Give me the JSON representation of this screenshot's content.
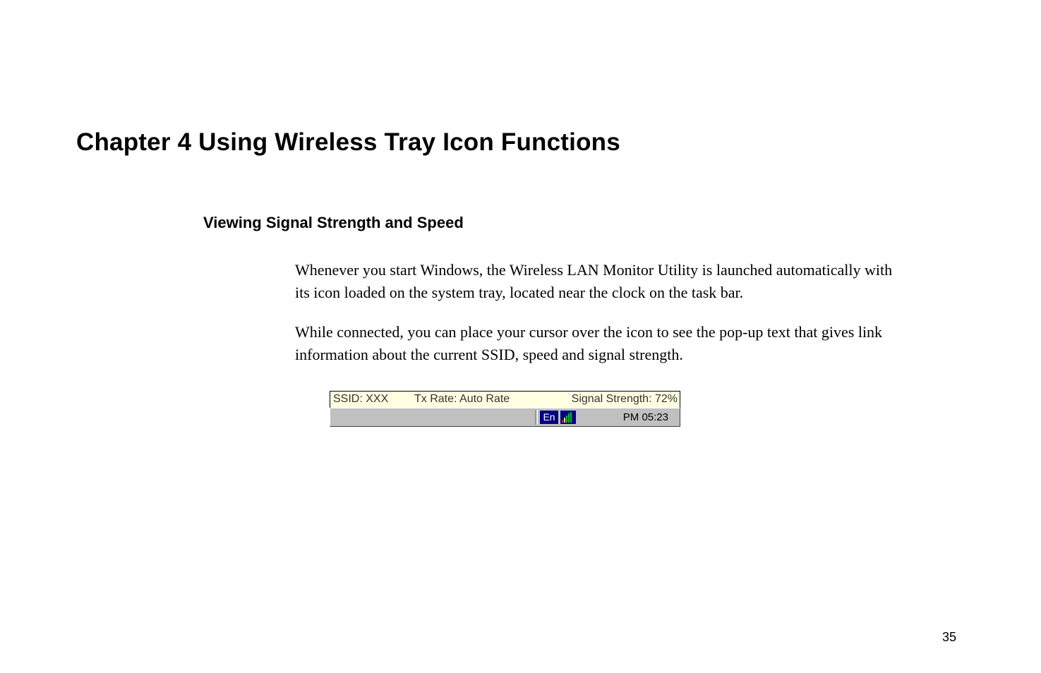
{
  "chapter": {
    "title": "Chapter 4    Using Wireless Tray Icon Functions"
  },
  "section": {
    "title": "Viewing Signal Strength and Speed"
  },
  "body": {
    "p1": "Whenever you start Windows, the Wireless LAN Monitor Utility is launched automatically with its icon loaded on the system tray, located near the clock on the task bar.",
    "p2": "While connected, you can place your cursor over the icon to see the pop-up text that gives link information about the current SSID, speed and signal strength."
  },
  "tooltip": {
    "ssid": "SSID: XXX",
    "tx_rate": "Tx Rate: Auto Rate",
    "signal_strength": "Signal Strength: 72%"
  },
  "taskbar": {
    "lang": "En",
    "clock": "PM 05:23"
  },
  "page_number": "35"
}
